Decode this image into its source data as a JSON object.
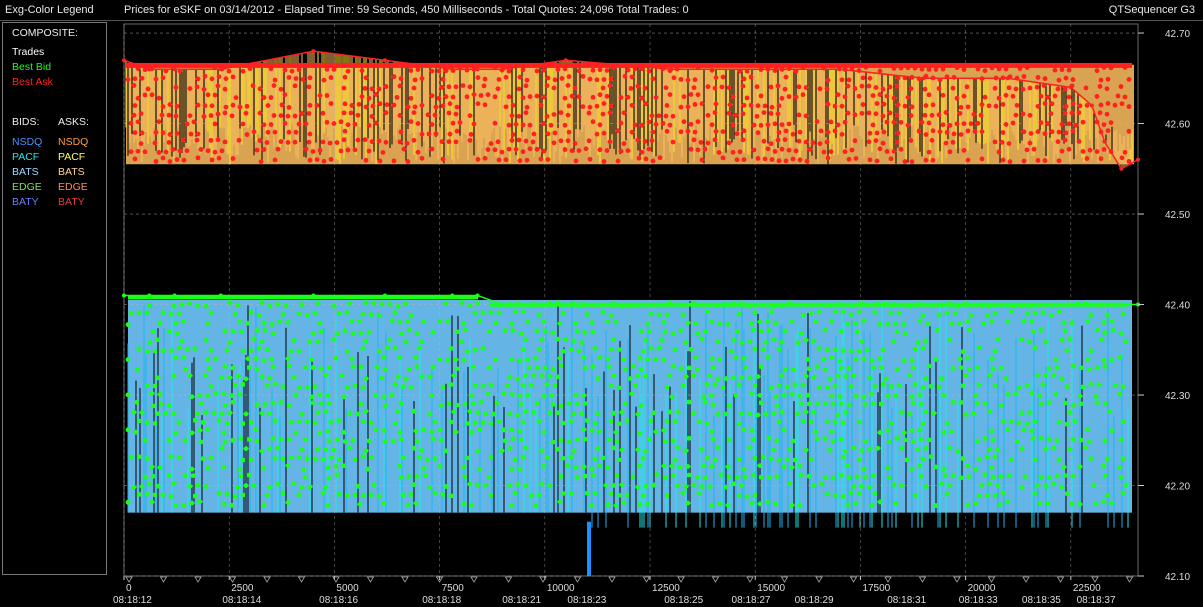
{
  "window": {
    "legend_title": "Exg-Color Legend",
    "app_name": "QTSequencer G3"
  },
  "legend": {
    "composite_label": "COMPOSITE:",
    "trades_label": "Trades",
    "best_bid_label": "Best Bid",
    "best_ask_label": "Best Ask",
    "bids_header": "BIDS:",
    "asks_header": "ASKS:",
    "rows": [
      {
        "bid": "NSDQ",
        "ask": "NSDQ",
        "bid_color": "#4f8fff",
        "ask_color": "#ff9a3c"
      },
      {
        "bid": "PACF",
        "ask": "PACF",
        "bid_color": "#22e6e6",
        "ask_color": "#ffff55"
      },
      {
        "bid": "BATS",
        "ask": "BATS",
        "bid_color": "#9fd8ff",
        "ask_color": "#ffd39a"
      },
      {
        "bid": "EDGE",
        "ask": "EDGE",
        "bid_color": "#7fdf5f",
        "ask_color": "#ff8a5a"
      },
      {
        "bid": "BATY",
        "ask": "BATY",
        "bid_color": "#6a7fff",
        "ask_color": "#e23b3b"
      }
    ]
  },
  "colors": {
    "trades": "#ffffff",
    "best_bid": "#19ff19",
    "best_ask": "#ff2020",
    "bid_fill": "#6fc8ff",
    "ask_fill": "#ffc060",
    "ask_fill_bright": "#ffee22"
  },
  "chart_data": {
    "type": "line",
    "title": "Prices for  eSKF  on  03/14/2012  -  Elapsed Time: 59 Seconds, 450 Milliseconds  -  Total Quotes: 24,096  Total Trades: 0",
    "xlim": [
      0,
      24096
    ],
    "ylim": [
      42.1,
      42.71
    ],
    "y_ticks": [
      "42.10",
      "42.20",
      "42.30",
      "42.40",
      "42.50",
      "42.60",
      "42.70"
    ],
    "x_ticks": [
      {
        "value": 0,
        "label": "0"
      },
      {
        "value": 2500,
        "label": "2500"
      },
      {
        "value": 5000,
        "label": "5000"
      },
      {
        "value": 7500,
        "label": "7500"
      },
      {
        "value": 10000,
        "label": "10000"
      },
      {
        "value": 12500,
        "label": "12500"
      },
      {
        "value": 15000,
        "label": "15000"
      },
      {
        "value": 17500,
        "label": "17500"
      },
      {
        "value": 20000,
        "label": "20000"
      },
      {
        "value": 22500,
        "label": "22500"
      }
    ],
    "time_labels": [
      {
        "value": 200,
        "label": "08:18:12"
      },
      {
        "value": 2800,
        "label": "08:18:14"
      },
      {
        "value": 5100,
        "label": "08:18:16"
      },
      {
        "value": 7550,
        "label": "08:18:18"
      },
      {
        "value": 9450,
        "label": "08:18:21"
      },
      {
        "value": 11000,
        "label": "08:18:23"
      },
      {
        "value": 13300,
        "label": "08:18:25"
      },
      {
        "value": 14900,
        "label": "08:18:27"
      },
      {
        "value": 16400,
        "label": "08:18:29"
      },
      {
        "value": 18600,
        "label": "08:18:31"
      },
      {
        "value": 20300,
        "label": "08:18:33"
      },
      {
        "value": 21800,
        "label": "08:18:35"
      },
      {
        "value": 23100,
        "label": "08:18:37"
      }
    ],
    "grid": true,
    "series": [
      {
        "name": "Best Ask",
        "x": [
          0,
          600,
          1200,
          2300,
          4500,
          6200,
          7800,
          8400,
          9000,
          10500,
          13000,
          15500,
          17000,
          19000,
          21000,
          22500,
          23000,
          23300,
          23700,
          24096
        ],
        "y": [
          42.67,
          42.66,
          42.66,
          42.66,
          42.68,
          42.67,
          42.66,
          42.66,
          42.66,
          42.67,
          42.66,
          42.66,
          42.66,
          42.65,
          42.65,
          42.64,
          42.62,
          42.58,
          42.55,
          42.56
        ]
      },
      {
        "name": "Best Bid",
        "x": [
          0,
          600,
          1200,
          2300,
          4500,
          6200,
          7800,
          8400,
          9000,
          10500,
          13000,
          15500,
          17000,
          19000,
          21000,
          22500,
          23000,
          23300,
          23700,
          24096
        ],
        "y": [
          42.41,
          42.41,
          42.41,
          42.41,
          42.41,
          42.41,
          42.41,
          42.41,
          42.4,
          42.4,
          42.4,
          42.4,
          42.4,
          42.4,
          42.4,
          42.4,
          42.4,
          42.4,
          42.4,
          42.4
        ]
      }
    ]
  }
}
